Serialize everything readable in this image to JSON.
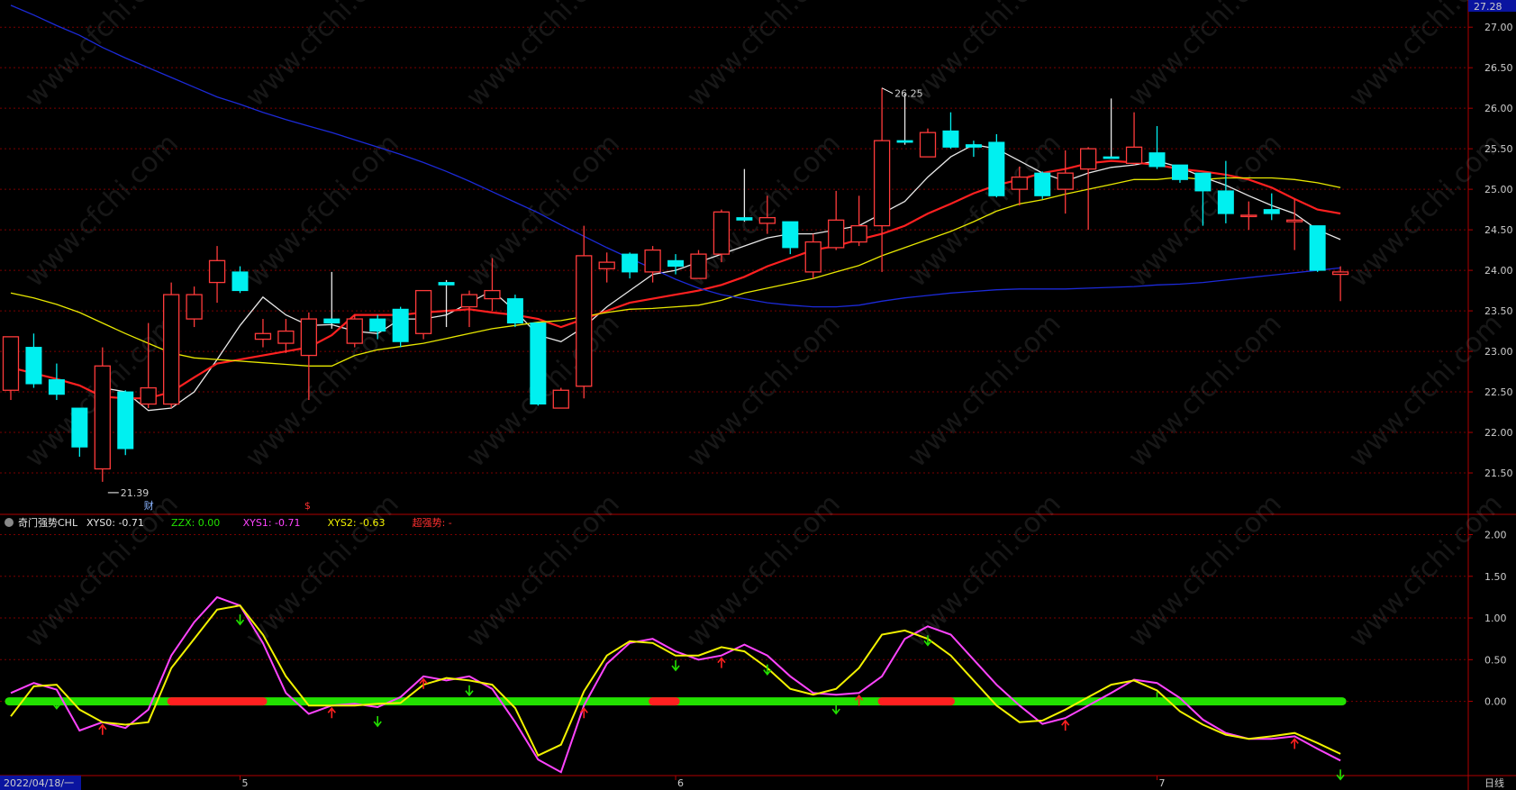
{
  "price_panel": {
    "top_label": "27.28",
    "high_marker": "26.25",
    "low_marker": "21.39",
    "event_marks": [
      {
        "text": "财",
        "color": "#8ab4ff",
        "index": 6
      },
      {
        "text": "$",
        "color": "#ff3030",
        "index": 13
      }
    ]
  },
  "indicator_panel": {
    "name": "奇门强势CHL",
    "items": [
      {
        "label": "XYS0:",
        "value": "-0.71",
        "color": "#e6e6e6"
      },
      {
        "label": "ZZX:",
        "value": "0.00",
        "color": "#22e000"
      },
      {
        "label": "XYS1:",
        "value": "-0.71",
        "color": "#ff44ff"
      },
      {
        "label": "XYS2:",
        "value": "-0.63",
        "color": "#f2f200"
      },
      {
        "label": "超强势:",
        "value": "-",
        "color": "#ff3030"
      }
    ]
  },
  "bottom_bar": {
    "date": "2022/04/18/一",
    "period": "日线",
    "month_labels": [
      {
        "text": "5",
        "index": 10
      },
      {
        "text": "6",
        "index": 29
      },
      {
        "text": "7",
        "index": 50
      }
    ]
  },
  "watermark": "www.cfchi.com",
  "colors": {
    "up": "#ff3b3b",
    "down": "#00f0f0",
    "ma_white": "#e8e8e8",
    "ma_red": "#ff2020",
    "ma_yellow": "#e8e800",
    "ma_blue": "#1c2ad8",
    "grid": "#7a0000",
    "axis": "#b00000"
  },
  "chart_data": [
    {
      "type": "candlestick",
      "title": "",
      "ylim": [
        21.0,
        27.28
      ],
      "y_ticks": [
        21.5,
        22.0,
        22.5,
        23.0,
        23.5,
        24.0,
        24.5,
        25.0,
        25.5,
        26.0,
        26.5,
        27.0
      ],
      "candles": [
        {
          "o": 22.52,
          "c": 23.18,
          "h": 23.18,
          "l": 22.4
        },
        {
          "o": 23.05,
          "c": 22.6,
          "h": 23.22,
          "l": 22.55
        },
        {
          "o": 22.65,
          "c": 22.47,
          "h": 22.85,
          "l": 22.4
        },
        {
          "o": 22.3,
          "c": 21.82,
          "h": 22.3,
          "l": 21.7
        },
        {
          "o": 21.55,
          "c": 22.82,
          "h": 23.05,
          "l": 21.39
        },
        {
          "o": 22.5,
          "c": 21.8,
          "h": 22.52,
          "l": 21.72
        },
        {
          "o": 22.35,
          "c": 22.55,
          "h": 23.35,
          "l": 22.3
        },
        {
          "o": 22.35,
          "c": 23.7,
          "h": 23.85,
          "l": 22.3
        },
        {
          "o": 23.4,
          "c": 23.7,
          "h": 23.8,
          "l": 23.3
        },
        {
          "o": 23.85,
          "c": 24.12,
          "h": 24.3,
          "l": 23.6
        },
        {
          "o": 23.98,
          "c": 23.75,
          "h": 24.05,
          "l": 23.72
        },
        {
          "o": 23.15,
          "c": 23.22,
          "h": 23.4,
          "l": 23.05
        },
        {
          "o": 23.1,
          "c": 23.25,
          "h": 23.4,
          "l": 22.98
        },
        {
          "o": 22.95,
          "c": 23.4,
          "h": 23.48,
          "l": 22.4
        },
        {
          "o": 23.4,
          "c": 23.35,
          "h": 23.98,
          "l": 23.28
        },
        {
          "o": 23.1,
          "c": 23.4,
          "h": 23.45,
          "l": 23.05
        },
        {
          "o": 23.4,
          "c": 23.25,
          "h": 23.45,
          "l": 23.15
        },
        {
          "o": 23.52,
          "c": 23.12,
          "h": 23.55,
          "l": 23.05
        },
        {
          "o": 23.22,
          "c": 23.75,
          "h": 23.75,
          "l": 23.15
        },
        {
          "o": 23.85,
          "c": 23.82,
          "h": 23.88,
          "l": 23.3
        },
        {
          "o": 23.55,
          "c": 23.7,
          "h": 23.75,
          "l": 23.3
        },
        {
          "o": 23.65,
          "c": 23.75,
          "h": 24.15,
          "l": 23.5
        },
        {
          "o": 23.65,
          "c": 23.35,
          "h": 23.7,
          "l": 23.3
        },
        {
          "o": 23.35,
          "c": 22.35,
          "h": 23.35,
          "l": 22.33
        },
        {
          "o": 22.3,
          "c": 22.52,
          "h": 22.55,
          "l": 22.3
        },
        {
          "o": 22.57,
          "c": 24.18,
          "h": 24.55,
          "l": 22.42
        },
        {
          "o": 24.02,
          "c": 24.1,
          "h": 24.22,
          "l": 23.85
        },
        {
          "o": 24.2,
          "c": 23.98,
          "h": 24.22,
          "l": 23.9
        },
        {
          "o": 23.98,
          "c": 24.25,
          "h": 24.3,
          "l": 23.85
        },
        {
          "o": 24.12,
          "c": 24.05,
          "h": 24.2,
          "l": 23.95
        },
        {
          "o": 23.9,
          "c": 24.2,
          "h": 24.25,
          "l": 23.9
        },
        {
          "o": 24.2,
          "c": 24.72,
          "h": 24.75,
          "l": 24.1
        },
        {
          "o": 24.65,
          "c": 24.62,
          "h": 25.25,
          "l": 24.6
        },
        {
          "o": 24.58,
          "c": 24.65,
          "h": 24.92,
          "l": 24.45
        },
        {
          "o": 24.6,
          "c": 24.28,
          "h": 24.6,
          "l": 24.2
        },
        {
          "o": 23.98,
          "c": 24.35,
          "h": 24.45,
          "l": 23.9
        },
        {
          "o": 24.28,
          "c": 24.62,
          "h": 24.98,
          "l": 24.25
        },
        {
          "o": 24.35,
          "c": 24.55,
          "h": 24.92,
          "l": 24.3
        },
        {
          "o": 24.55,
          "c": 25.6,
          "h": 26.25,
          "l": 23.98
        },
        {
          "o": 25.6,
          "c": 25.58,
          "h": 26.18,
          "l": 25.55
        },
        {
          "o": 25.4,
          "c": 25.7,
          "h": 25.75,
          "l": 25.4
        },
        {
          "o": 25.72,
          "c": 25.52,
          "h": 25.95,
          "l": 25.5
        },
        {
          "o": 25.55,
          "c": 25.52,
          "h": 25.6,
          "l": 25.4
        },
        {
          "o": 25.58,
          "c": 24.92,
          "h": 25.68,
          "l": 24.9
        },
        {
          "o": 25.0,
          "c": 25.15,
          "h": 25.28,
          "l": 24.8
        },
        {
          "o": 25.2,
          "c": 24.92,
          "h": 25.22,
          "l": 24.88
        },
        {
          "o": 25.0,
          "c": 25.2,
          "h": 25.48,
          "l": 24.7
        },
        {
          "o": 25.25,
          "c": 25.5,
          "h": 25.52,
          "l": 24.5
        },
        {
          "o": 25.4,
          "c": 25.38,
          "h": 26.12,
          "l": 25.38
        },
        {
          "o": 25.32,
          "c": 25.52,
          "h": 25.95,
          "l": 25.3
        },
        {
          "o": 25.45,
          "c": 25.28,
          "h": 25.78,
          "l": 25.25
        },
        {
          "o": 25.3,
          "c": 25.12,
          "h": 25.3,
          "l": 25.08
        },
        {
          "o": 25.2,
          "c": 24.98,
          "h": 25.2,
          "l": 24.55
        },
        {
          "o": 24.98,
          "c": 24.7,
          "h": 25.35,
          "l": 24.58
        },
        {
          "o": 24.68,
          "c": 24.68,
          "h": 24.85,
          "l": 24.5
        },
        {
          "o": 24.75,
          "c": 24.7,
          "h": 24.95,
          "l": 24.62
        },
        {
          "o": 24.6,
          "c": 24.62,
          "h": 24.88,
          "l": 24.25
        },
        {
          "o": 24.55,
          "c": 24.0,
          "h": 24.55,
          "l": 23.98
        },
        {
          "o": 23.95,
          "c": 23.98,
          "h": 24.05,
          "l": 23.62
        }
      ],
      "series": [
        {
          "name": "MA5",
          "color": "#e8e8e8",
          "values": [
            null,
            null,
            null,
            null,
            22.55,
            22.5,
            22.27,
            22.3,
            22.5,
            22.9,
            23.32,
            23.67,
            23.45,
            23.32,
            23.33,
            23.25,
            23.22,
            23.4,
            23.4,
            23.45,
            23.6,
            23.75,
            23.5,
            23.2,
            23.12,
            23.3,
            23.55,
            23.75,
            23.95,
            24.0,
            24.1,
            24.2,
            24.3,
            24.4,
            24.45,
            24.45,
            24.5,
            24.55,
            24.7,
            24.85,
            25.15,
            25.4,
            25.55,
            25.5,
            25.35,
            25.2,
            25.1,
            25.2,
            25.27,
            25.3,
            25.35,
            25.27,
            25.15,
            25.05,
            24.92,
            24.8,
            24.7,
            24.5,
            24.38
          ]
        },
        {
          "name": "MA10",
          "color": "#ff2020",
          "values": [
            22.8,
            22.73,
            22.66,
            22.58,
            22.44,
            22.42,
            22.42,
            22.5,
            22.68,
            22.85,
            22.9,
            22.95,
            23.0,
            23.05,
            23.2,
            23.45,
            23.45,
            23.45,
            23.48,
            23.5,
            23.52,
            23.48,
            23.45,
            23.4,
            23.3,
            23.4,
            23.5,
            23.6,
            23.65,
            23.7,
            23.75,
            23.82,
            23.92,
            24.05,
            24.15,
            24.25,
            24.3,
            24.38,
            24.45,
            24.55,
            24.7,
            24.82,
            24.95,
            25.05,
            25.12,
            25.2,
            25.25,
            25.32,
            25.35,
            25.33,
            25.3,
            25.25,
            25.22,
            25.18,
            25.12,
            25.02,
            24.88,
            24.75,
            24.7
          ]
        },
        {
          "name": "MA20",
          "color": "#e8e800",
          "values": [
            23.72,
            23.66,
            23.58,
            23.48,
            23.35,
            23.22,
            23.1,
            22.98,
            22.92,
            22.9,
            22.88,
            22.86,
            22.84,
            22.82,
            22.82,
            22.95,
            23.02,
            23.06,
            23.1,
            23.16,
            23.22,
            23.28,
            23.32,
            23.36,
            23.38,
            23.43,
            23.48,
            23.52,
            23.53,
            23.55,
            23.57,
            23.63,
            23.72,
            23.78,
            23.84,
            23.9,
            23.98,
            24.06,
            24.18,
            24.28,
            24.38,
            24.48,
            24.6,
            24.73,
            24.82,
            24.87,
            24.94,
            25.0,
            25.06,
            25.12,
            25.12,
            25.15,
            25.12,
            25.14,
            25.14,
            25.14,
            25.12,
            25.08,
            25.02
          ]
        },
        {
          "name": "MA60",
          "color": "#1c2ad8",
          "values": [
            27.27,
            27.15,
            27.02,
            26.9,
            26.75,
            26.62,
            26.5,
            26.38,
            26.26,
            26.14,
            26.05,
            25.95,
            25.86,
            25.78,
            25.7,
            25.61,
            25.52,
            25.43,
            25.33,
            25.22,
            25.1,
            24.97,
            24.84,
            24.71,
            24.56,
            24.42,
            24.28,
            24.15,
            24.02,
            23.89,
            23.78,
            23.7,
            23.65,
            23.6,
            23.57,
            23.55,
            23.55,
            23.57,
            23.62,
            23.66,
            23.69,
            23.72,
            23.74,
            23.76,
            23.77,
            23.77,
            23.77,
            23.78,
            23.79,
            23.8,
            23.82,
            23.83,
            23.85,
            23.88,
            23.91,
            23.94,
            23.97,
            24.0,
            24.03
          ]
        }
      ]
    },
    {
      "type": "line",
      "title": "奇门强势CHL",
      "ylim": [
        -0.88,
        2.2
      ],
      "y_ticks": [
        0.0,
        0.5,
        1.0,
        1.5,
        2.0
      ],
      "series": [
        {
          "name": "XYS1",
          "color": "#ff44ff",
          "values": [
            0.1,
            0.22,
            0.14,
            -0.35,
            -0.25,
            -0.32,
            -0.1,
            0.55,
            0.95,
            1.25,
            1.15,
            0.7,
            0.1,
            -0.15,
            -0.05,
            -0.03,
            -0.07,
            0.05,
            0.3,
            0.25,
            0.3,
            0.15,
            -0.25,
            -0.7,
            -0.85,
            -0.05,
            0.45,
            0.7,
            0.75,
            0.6,
            0.5,
            0.55,
            0.68,
            0.55,
            0.3,
            0.1,
            0.08,
            0.1,
            0.3,
            0.75,
            0.9,
            0.8,
            0.5,
            0.2,
            -0.05,
            -0.27,
            -0.2,
            -0.05,
            0.1,
            0.26,
            0.22,
            0.04,
            -0.22,
            -0.38,
            -0.45,
            -0.45,
            -0.42,
            -0.57,
            -0.71
          ]
        },
        {
          "name": "XYS2",
          "color": "#f2f200",
          "values": [
            -0.18,
            0.18,
            0.2,
            -0.1,
            -0.25,
            -0.28,
            -0.25,
            0.4,
            0.75,
            1.1,
            1.15,
            0.8,
            0.3,
            -0.05,
            -0.05,
            -0.05,
            -0.03,
            -0.02,
            0.2,
            0.28,
            0.25,
            0.2,
            -0.08,
            -0.65,
            -0.52,
            0.12,
            0.55,
            0.72,
            0.7,
            0.55,
            0.55,
            0.65,
            0.6,
            0.4,
            0.15,
            0.08,
            0.15,
            0.4,
            0.8,
            0.85,
            0.75,
            0.55,
            0.25,
            -0.05,
            -0.25,
            -0.23,
            -0.1,
            0.05,
            0.2,
            0.25,
            0.13,
            -0.12,
            -0.28,
            -0.4,
            -0.45,
            -0.42,
            -0.38,
            -0.5,
            -0.63
          ]
        },
        {
          "name": "ZZX",
          "color": "#22e000",
          "values": [
            0,
            0,
            0,
            0,
            0,
            0,
            0,
            0,
            0,
            0,
            0,
            0,
            0,
            0,
            0,
            0,
            0,
            0,
            0,
            0,
            0,
            0,
            0,
            0,
            0,
            0,
            0,
            0,
            0,
            0,
            0,
            0,
            0,
            0,
            0,
            0,
            0,
            0,
            0,
            0,
            0,
            0,
            0,
            0,
            0,
            0,
            0,
            0,
            0,
            0,
            0,
            0,
            0,
            0,
            0,
            0,
            0,
            0,
            0
          ]
        }
      ],
      "strong_segments": [
        [
          7,
          11
        ],
        [
          28,
          29
        ],
        [
          38,
          41
        ]
      ],
      "down_arrows": [
        2,
        10,
        16,
        20,
        29,
        33,
        36,
        40,
        50,
        58
      ],
      "up_arrows": [
        4,
        14,
        18,
        25,
        31,
        37,
        46,
        56
      ]
    }
  ]
}
